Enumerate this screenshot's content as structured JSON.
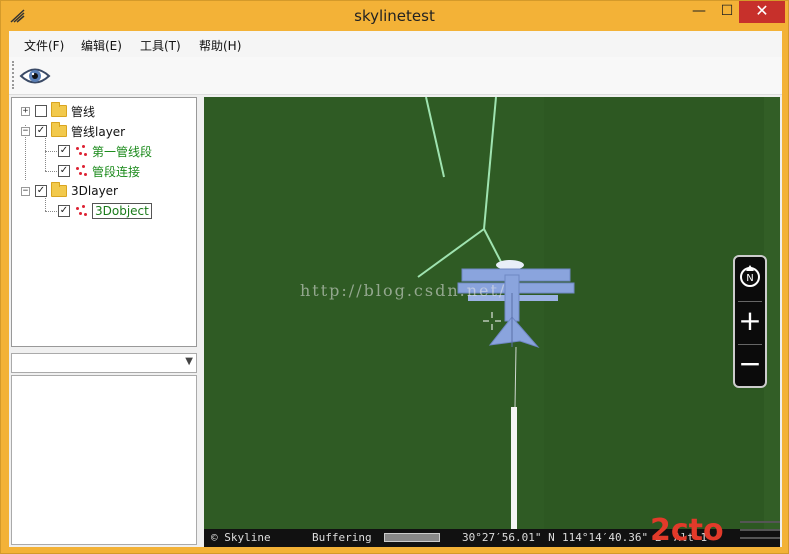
{
  "window": {
    "title": "skylinetest",
    "controls": {
      "minimize": "—",
      "maximize": "☐",
      "close": "✕"
    }
  },
  "menu": {
    "items": [
      "文件(F)",
      "编辑(E)",
      "工具(T)",
      "帮助(H)"
    ]
  },
  "toolbar": {
    "buttons": [
      {
        "icon": "eye-icon"
      }
    ]
  },
  "tree": {
    "nodes": [
      {
        "label": "管线",
        "checked": false,
        "expanded": false,
        "type": "folder"
      },
      {
        "label": "管线layer",
        "checked": true,
        "expanded": true,
        "type": "folder"
      },
      {
        "label": "第一管线段",
        "checked": true,
        "type": "layer"
      },
      {
        "label": "管段连接",
        "checked": true,
        "type": "layer"
      },
      {
        "label": "3Dlayer",
        "checked": true,
        "expanded": true,
        "type": "folder"
      },
      {
        "label": "3Dobject",
        "checked": true,
        "type": "layer",
        "selected": true
      }
    ]
  },
  "combo": {
    "value": ""
  },
  "viewport": {
    "watermark": "http://blog.csdn.net/",
    "nav": {
      "north": "N",
      "zoom_in": "+",
      "zoom_out": "−"
    }
  },
  "status": {
    "copyright": "© Skyline",
    "buffering": "Buffering",
    "lat": "30°27′56.01\" N",
    "lon": "114°14′40.36\" E",
    "alt": "Alt 1"
  },
  "colors": {
    "terrain": "#2f5b24",
    "pipe": "#9fe3b0",
    "plane": "#8aa4dd",
    "title_accent": "#f3b237",
    "close": "#c7302b"
  }
}
